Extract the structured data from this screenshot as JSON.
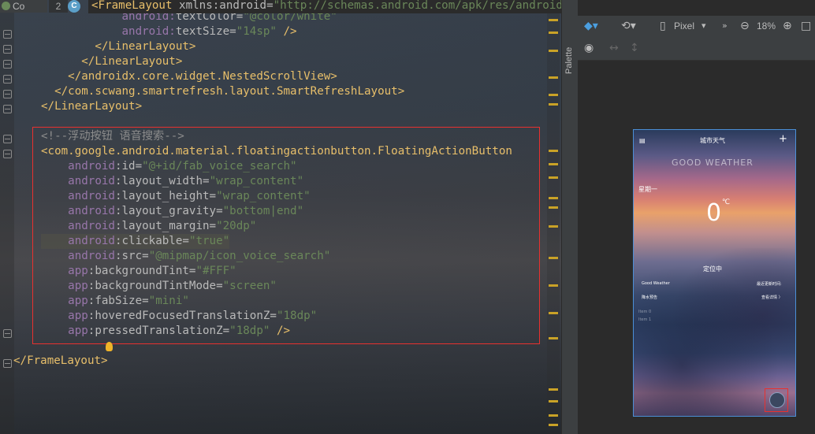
{
  "header": {
    "tab_label": "Co",
    "line_number": "2",
    "class_icon": "C",
    "code": {
      "tag": "<FrameLayout",
      "attr": " xmlns:android=",
      "value": "\"http://schemas.android.com/apk/res/android\""
    }
  },
  "code_lines": [
    {
      "pre": "            ",
      "ns": "android:",
      "attr": "textColor=",
      "val": "\"@color/white\""
    },
    {
      "pre": "            ",
      "ns": "android:",
      "attr": "textSize=",
      "val": "\"14sp\"",
      "tail": " />"
    },
    {
      "tag": "        </LinearLayout>"
    },
    {
      "tag": "      </LinearLayout>"
    },
    {
      "tag": "    </androidx.core.widget.NestedScrollView>"
    },
    {
      "tag": "  </com.scwang.smartrefresh.layout.SmartRefreshLayout>"
    },
    {
      "tag": "</LinearLayout>"
    },
    {
      "tag": ""
    },
    {
      "comment": "<!--浮动按钮 语音搜索-->"
    },
    {
      "tag": "<com.google.android.material.floatingactionbutton.FloatingActionButton"
    },
    {
      "pre": "    ",
      "ns": "android",
      "attr": ":id=",
      "val": "\"@+id/fab_voice_search\""
    },
    {
      "pre": "    ",
      "ns": "android",
      "attr": ":layout_width=",
      "val": "\"wrap_content\""
    },
    {
      "pre": "    ",
      "ns": "android",
      "attr": ":layout_height=",
      "val": "\"wrap_content\""
    },
    {
      "pre": "    ",
      "ns": "android",
      "attr": ":layout_gravity=",
      "val": "\"bottom|end\""
    },
    {
      "pre": "    ",
      "ns": "android",
      "attr": ":layout_margin=",
      "val": "\"20dp\""
    },
    {
      "pre": "    ",
      "ns": "android",
      "attr": ":clickable=",
      "val": "\"true\""
    },
    {
      "pre": "    ",
      "ns": "android",
      "attr": ":src=",
      "val": "\"@mipmap/icon_voice_search\""
    },
    {
      "pre": "    ",
      "ns": "app",
      "attr": ":backgroundTint=",
      "val": "\"#FFF\""
    },
    {
      "pre": "    ",
      "ns": "app",
      "attr": ":backgroundTintMode=",
      "val": "\"screen\""
    },
    {
      "pre": "    ",
      "ns": "app",
      "attr": ":fabSize=",
      "val": "\"mini\""
    },
    {
      "pre": "    ",
      "ns": "app",
      "attr": ":hoveredFocusedTranslationZ=",
      "val": "\"18dp\""
    },
    {
      "pre": "    ",
      "ns": "app",
      "attr": ":pressedTranslationZ=",
      "val": "\"18dp\"",
      "tail": " />"
    },
    {
      "tag": ""
    },
    {
      "tag": "</FrameLayout>"
    }
  ],
  "design": {
    "palette_label": "Palette",
    "device": "Pixel",
    "zoom": "18%"
  },
  "preview": {
    "title": "城市天气",
    "plus": "+",
    "logo_text": "GOOD WEATHER",
    "weekday": "星期一",
    "temperature": "0",
    "unit": "℃",
    "location": "定位中",
    "good_weather": "Good Weather",
    "update_label": "最近更新时间:",
    "rain_label": "降水预告",
    "detail_label": "查看详情 〉",
    "item0": "Item 0",
    "item1": "Item 1"
  },
  "colors": {
    "tag": "#e8bf6a",
    "namespace": "#9876aa",
    "value": "#6a8759",
    "comment": "#8c8c8c",
    "selection": "#e8312f",
    "device_frame": "#4b8fd6"
  }
}
